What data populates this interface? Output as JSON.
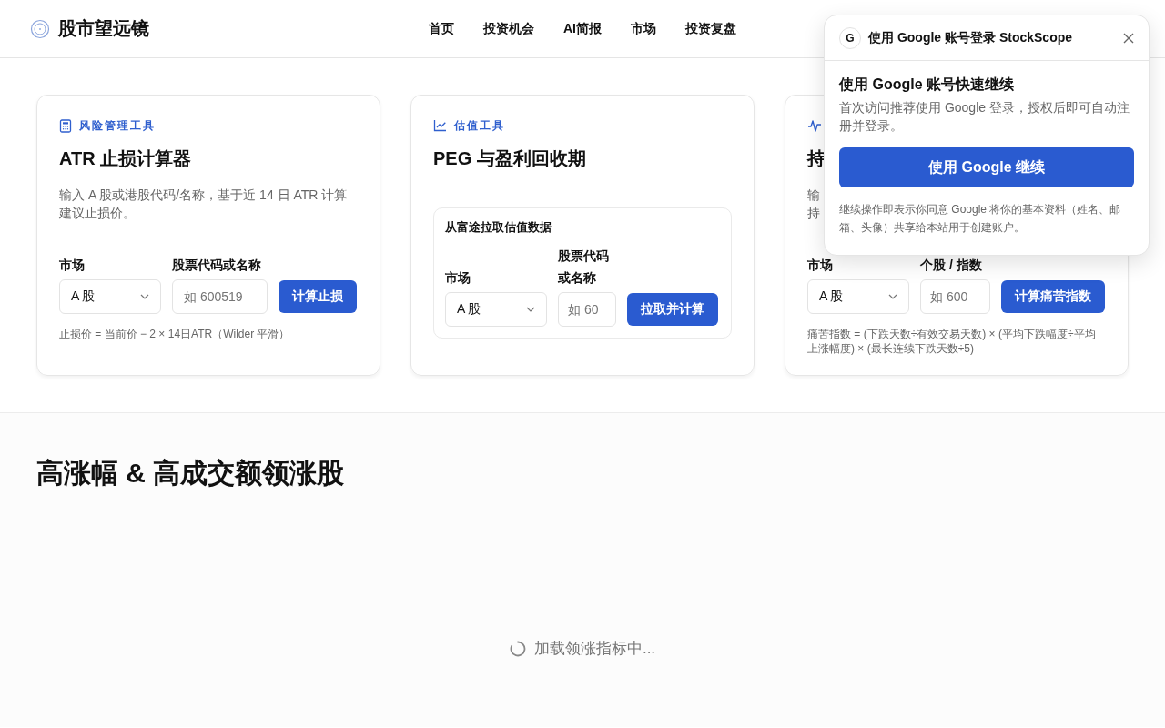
{
  "header": {
    "logo": "股市望远镜",
    "nav": [
      {
        "label": "首页"
      },
      {
        "label": "投资机会"
      },
      {
        "label": "AI简报"
      },
      {
        "label": "市场"
      },
      {
        "label": "投资复盘"
      }
    ]
  },
  "tool_cards": [
    {
      "category": "风险管理工具",
      "title": "ATR 止损计算器",
      "description": [
        "输入 A 股或港股代码/名称，基于近 14 日 ATR 计算建议止损价。"
      ],
      "market_label": "市场",
      "market_value": "A 股",
      "code_label": "股票代码或名称",
      "code_placeholder": "如 600519",
      "button": "计算止损",
      "formula": "止损价 = 当前价 − 2 × 14日ATR（Wilder 平滑）"
    },
    {
      "category": "估值工具",
      "title": "PEG 与盈利回收期",
      "panel_title": "从富途拉取估值数据",
      "market_label": "市场",
      "market_value": "A 股",
      "code_label": "股票代码或名称",
      "code_placeholder": "如 60",
      "button": "拉取并计算"
    },
    {
      "title": "持",
      "description": [
        "输",
        "持"
      ],
      "market_label": "市场",
      "market_value": "A 股",
      "code_label": "个股 / 指数",
      "code_placeholder": "如 600",
      "button": "计算痛苦指数",
      "formula": "痛苦指数 = (下跌天数÷有效交易天数) × (平均下跌幅度÷平均上涨幅度) × (最长连续下跌天数÷5)"
    }
  ],
  "leaders_section": {
    "title": "高涨幅 & 高成交额领涨股",
    "loading_text": "加载领涨指标中..."
  },
  "login_popup": {
    "badge": "G",
    "title": "使用 Google 账号登录 StockScope",
    "heading": "使用 Google 账号快速继续",
    "description": "首次访问推荐使用 Google 登录，授权后即可自动注册并登录。",
    "button": "使用 Google 继续",
    "note": "继续操作即表示你同意 Google 将你的基本资料（姓名、邮箱、头像）共享给本站用于创建账户。"
  }
}
